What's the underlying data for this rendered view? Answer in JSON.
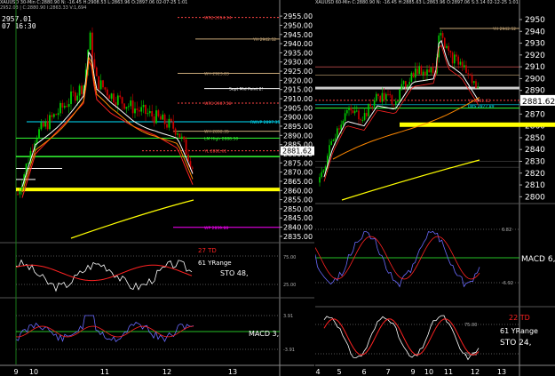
{
  "colors": {
    "background": "#000000",
    "price_bar_up": "#00cc00",
    "price_bar_down": "#cc0000",
    "yellow_line": "#ffff00",
    "orange_ma": "#ff8800",
    "white_ma": "#ffffff",
    "red_ma": "#ff2222",
    "cyan": "#00e5ff",
    "green_level": "#33ff33",
    "magenta": "#ff00ff",
    "brown_level": "#c8a878"
  },
  "left_chart": {
    "header": "XAUUSD 30-Min C:2880.90 N: -16.45 H:2908.53 L:2863.96 O:2897.06 02-07-25 1:01",
    "sub_header": "2952.03 | C:2880.90 I:2863.33 V:1,694",
    "crosshair_price": "2957.01",
    "crosshair_time": "07 16:30",
    "price_label": "2881.62",
    "y_ticks": [
      "2955.00",
      "2950.00",
      "2945.00",
      "2940.00",
      "2935.00",
      "2930.00",
      "2925.00",
      "2920.00",
      "2915.00",
      "2910.00",
      "2905.00",
      "2900.00",
      "2895.00",
      "2890.00",
      "2885.00",
      "2880.00",
      "2875.00",
      "2870.00",
      "2865.00",
      "2860.00",
      "2855.00",
      "2850.00",
      "2845.00",
      "2840.00",
      "2835.00"
    ],
    "x_ticks": [
      "9",
      "10",
      "11",
      "12",
      "13"
    ],
    "annotations": [
      {
        "text": "WR2 2954.34",
        "color": "#ff4444"
      },
      {
        "text": "YH 2942.52",
        "color": "#c8a878"
      },
      {
        "text": "WH 2923.83",
        "color": "#c8a878"
      },
      {
        "text": "Sept Mid Point 2!",
        "color": "#ffffff"
      },
      {
        "text": "WR1 2907.58",
        "color": "#ff4444"
      },
      {
        "text": "WH 2892.35",
        "color": "#c8a878"
      },
      {
        "text": "RWVP 2897.35",
        "color": "#00e5ff"
      },
      {
        "text": "LM High 2888.50",
        "color": "#33ff33"
      },
      {
        "text": "YL 2881.61",
        "color": "#ff4444"
      },
      {
        "text": "WP 2839.88",
        "color": "#ff00ff"
      }
    ],
    "stochastic": {
      "label_td": "27 TD",
      "label_range": "61 YRange",
      "label_sto": "STO 48,",
      "levels": [
        "75.00",
        "25.00"
      ]
    },
    "macd": {
      "label": "MACD 3,",
      "levels": [
        "3.91",
        "-3.91"
      ]
    }
  },
  "right_chart": {
    "header": "XAUUSD 60-Min C:2880.90 N: -16.45 H:2885.63 L:2863.96 O:2897.06 S:3.14 02-12-25 1:01",
    "price_label": "2881.62",
    "y_ticks": [
      "2950",
      "2940",
      "2930",
      "2920",
      "2910",
      "2900",
      "2890",
      "2880",
      "2870",
      "2860",
      "2850",
      "2840",
      "2830",
      "2820",
      "2810",
      "2800"
    ],
    "x_ticks": [
      "4",
      "5",
      "6",
      "7",
      "9",
      "10",
      "11",
      "12",
      "13"
    ],
    "annotations": [
      {
        "text": "YH 2942.52",
        "color": "#c8a878"
      },
      {
        "text": "YL 2881.62",
        "color": "#ff4444"
      },
      {
        "text": "LWS 2877.89",
        "color": "#00e5ff"
      }
    ],
    "macd": {
      "label": "MACD 6,",
      "levels": [
        "6.82",
        "-6.92"
      ]
    },
    "stochastic": {
      "label_td": "22 TD",
      "label_range": "61 YRange",
      "label_sto": "STO 24,",
      "levels": [
        "75.00",
        "25.00"
      ]
    }
  }
}
